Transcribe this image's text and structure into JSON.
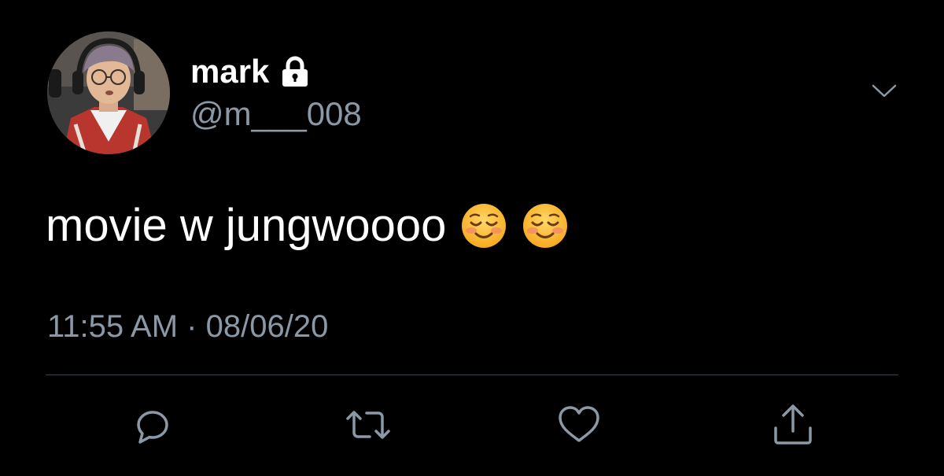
{
  "user": {
    "display_name": "mark",
    "handle": "@m___008",
    "protected_icon": "lock-icon",
    "avatar_icon": "profile-photo"
  },
  "tweet": {
    "text": "movie w jungwoooo",
    "emojis": [
      "smiling-face-emoji",
      "smiling-face-emoji"
    ],
    "time": "11:55 AM",
    "separator": "·",
    "date": "08/06/20"
  },
  "actions": [
    {
      "icon": "reply-icon"
    },
    {
      "icon": "retweet-icon"
    },
    {
      "icon": "like-icon"
    },
    {
      "icon": "share-icon"
    }
  ],
  "colors": {
    "background": "#000000",
    "primary_text": "#ffffff",
    "secondary_text": "#8b98a5",
    "divider": "#38444d"
  }
}
